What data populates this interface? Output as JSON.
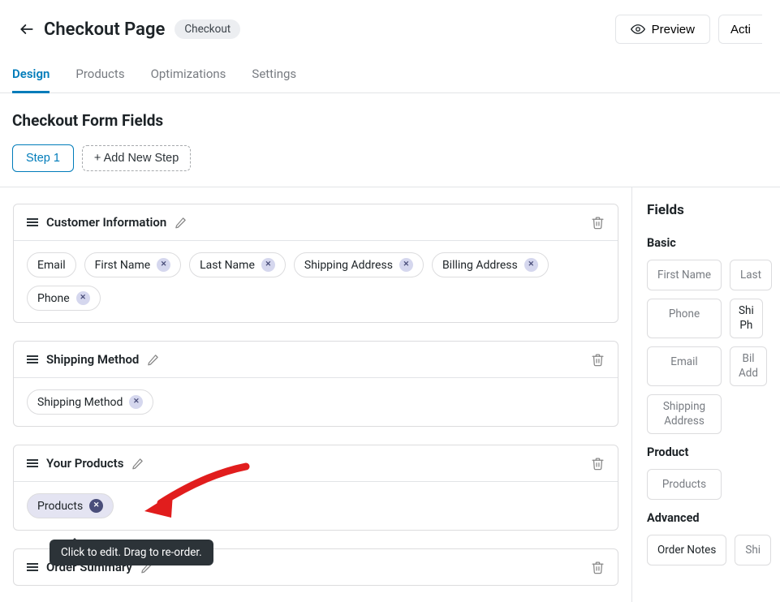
{
  "header": {
    "title": "Checkout Page",
    "badge": "Checkout",
    "preview_label": "Preview",
    "actions_label": "Acti"
  },
  "tabs": [
    "Design",
    "Products",
    "Optimizations",
    "Settings"
  ],
  "active_tab": 0,
  "section_heading": "Checkout Form Fields",
  "steps": {
    "active": "Step 1",
    "add_label": "+ Add New Step"
  },
  "cards": [
    {
      "title": "Customer Information",
      "fields": [
        "Email",
        "First Name",
        "Last Name",
        "Shipping Address",
        "Billing Address",
        "Phone"
      ]
    },
    {
      "title": "Shipping Method",
      "fields": [
        "Shipping Method"
      ]
    },
    {
      "title": "Your Products",
      "fields": [
        "Products"
      ],
      "highlight_field_index": 0
    },
    {
      "title": "Order Summary",
      "fields": []
    }
  ],
  "tooltip": "Click to edit. Drag to re-order.",
  "sidebar": {
    "heading": "Fields",
    "groups": [
      {
        "title": "Basic",
        "rows": [
          [
            "First Name",
            "Last "
          ],
          [
            "Phone",
            "Shi\nPh"
          ],
          [
            "Email",
            "Bil\nAdd"
          ],
          [
            "Shipping\nAddress"
          ]
        ]
      },
      {
        "title": "Product",
        "rows": [
          [
            "Products"
          ]
        ]
      },
      {
        "title": "Advanced",
        "rows": [
          [
            "Order Notes",
            "Shi"
          ]
        ]
      }
    ]
  }
}
